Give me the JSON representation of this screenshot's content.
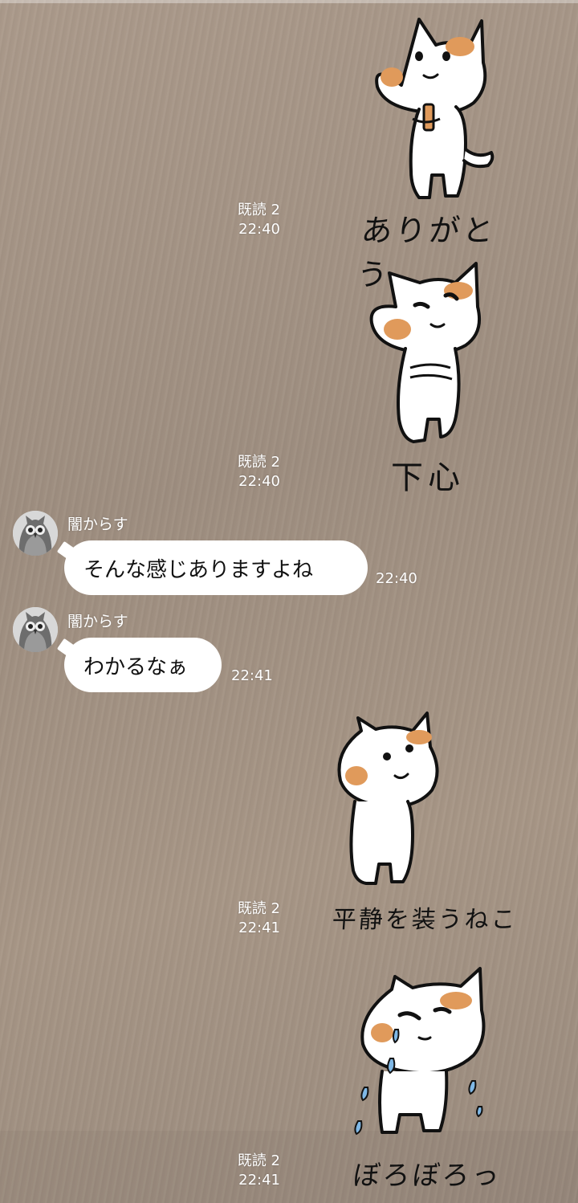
{
  "messages": [
    {
      "type": "sticker",
      "side": "right",
      "sticker": "cat-holding-phone-icon",
      "caption": "ありがとう",
      "read": "既読 2",
      "time": "22:40"
    },
    {
      "type": "sticker",
      "side": "right",
      "sticker": "cat-bowing-icon",
      "caption": "下心",
      "read": "既読 2",
      "time": "22:40"
    },
    {
      "type": "text",
      "side": "left",
      "sender": "闇からす",
      "avatar": "owl-avatar-icon",
      "text": "そんな感じありますよね",
      "time": "22:40"
    },
    {
      "type": "text",
      "side": "left",
      "sender": "闇からす",
      "avatar": "owl-avatar-icon",
      "text": "わかるなぁ",
      "time": "22:41"
    },
    {
      "type": "sticker",
      "side": "right",
      "sticker": "cat-standing-icon",
      "caption": "平静を装うねこ",
      "read": "既読 2",
      "time": "22:41"
    },
    {
      "type": "sticker",
      "side": "right",
      "sticker": "cat-crying-icon",
      "caption": "ぼろぼろっ",
      "read": "既読 2",
      "time": "22:41"
    }
  ],
  "colors": {
    "cat_patch": "#e09a5b",
    "bubble": "#ffffff",
    "outline": "#111111",
    "tear": "#7fb8e6"
  }
}
